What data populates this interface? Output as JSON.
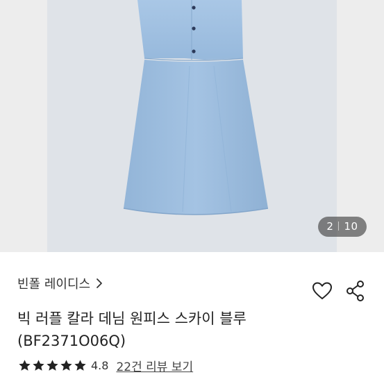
{
  "gallery": {
    "current": "2",
    "total": "10"
  },
  "product": {
    "brand": "빈폴 레이디스",
    "title_line1": "빅 러플 칼라 데님 원피스 스카이 블루",
    "title_line2": "(BF2371O06Q)",
    "rating": 4.8,
    "rating_text": "4.8",
    "reviews_link": "22건 리뷰 보기"
  },
  "icons": {
    "brand_chevron": "chevron-right-icon",
    "favorite": "heart-outline-icon",
    "share": "share-icon",
    "star": "star-icon"
  },
  "colors": {
    "denim": "#9dbfe0",
    "gallery_bg": "#ededed",
    "photo_bg": "#dfe3e8",
    "text": "#222222"
  }
}
